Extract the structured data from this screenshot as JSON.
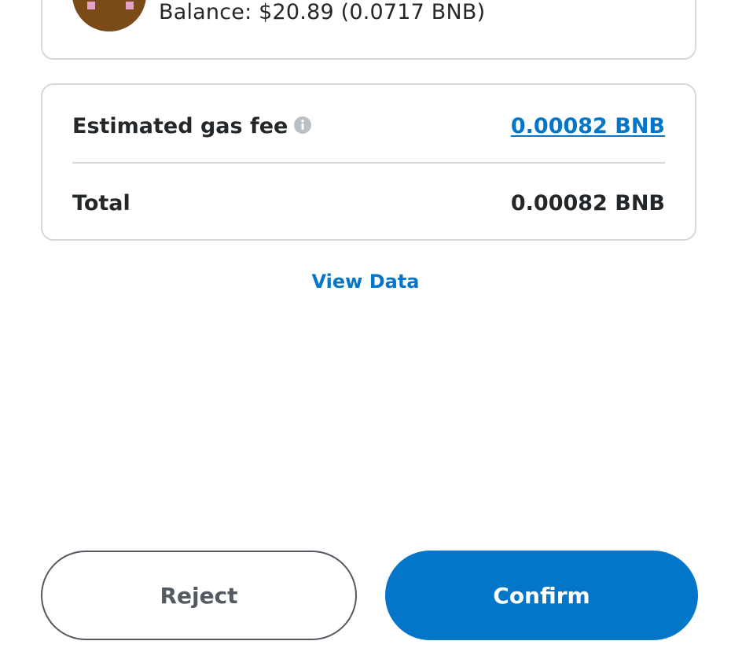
{
  "account": {
    "balance_text": "Balance: $20.89 (0.0717 BNB)"
  },
  "fees": {
    "estimated_gas_fee_label": "Estimated gas fee",
    "estimated_gas_fee_value": "0.00082 BNB",
    "total_label": "Total",
    "total_value": "0.00082 BNB"
  },
  "view_data_label": "View Data",
  "actions": {
    "reject_label": "Reject",
    "confirm_label": "Confirm"
  },
  "icons": {
    "info": "info-icon",
    "avatar": "identicon-avatar"
  },
  "colors": {
    "primary": "#0376c9",
    "text": "#24272a",
    "border": "#d6d9dc",
    "secondary_text": "#535a61",
    "avatar_base": "#7a4a18",
    "avatar_accent": "#e7a1c8"
  }
}
